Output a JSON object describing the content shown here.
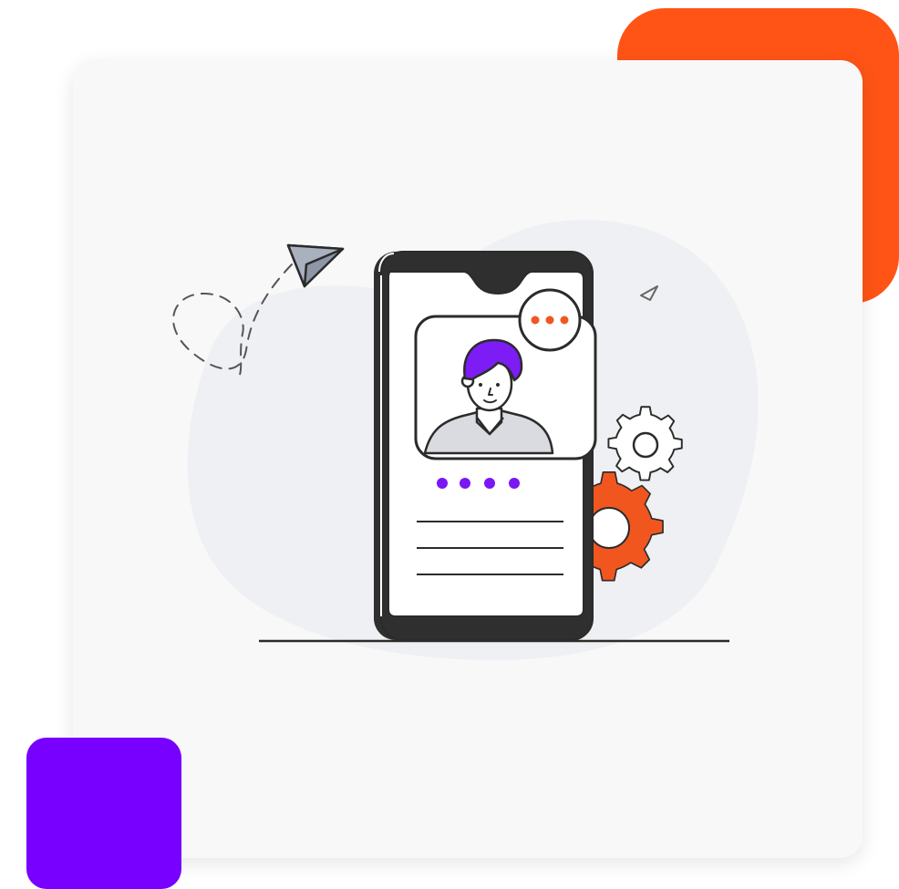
{
  "colors": {
    "orange_accent": "#ff5416",
    "purple_accent": "#7700ff",
    "card_bg": "#f8f8f9",
    "blob_bg": "#eef0f3",
    "outline": "#2b2b2b",
    "gear_orange": "#f1561f",
    "hair_purple": "#7d1cf5",
    "dot_purple": "#7a17f2"
  },
  "illustration": {
    "icons": [
      "paper-plane-icon",
      "chat-bubble-icon",
      "gear-icon",
      "avatar",
      "smartphone"
    ],
    "pagination_dots": 4,
    "message_dots": 3,
    "text_lines": 3
  }
}
